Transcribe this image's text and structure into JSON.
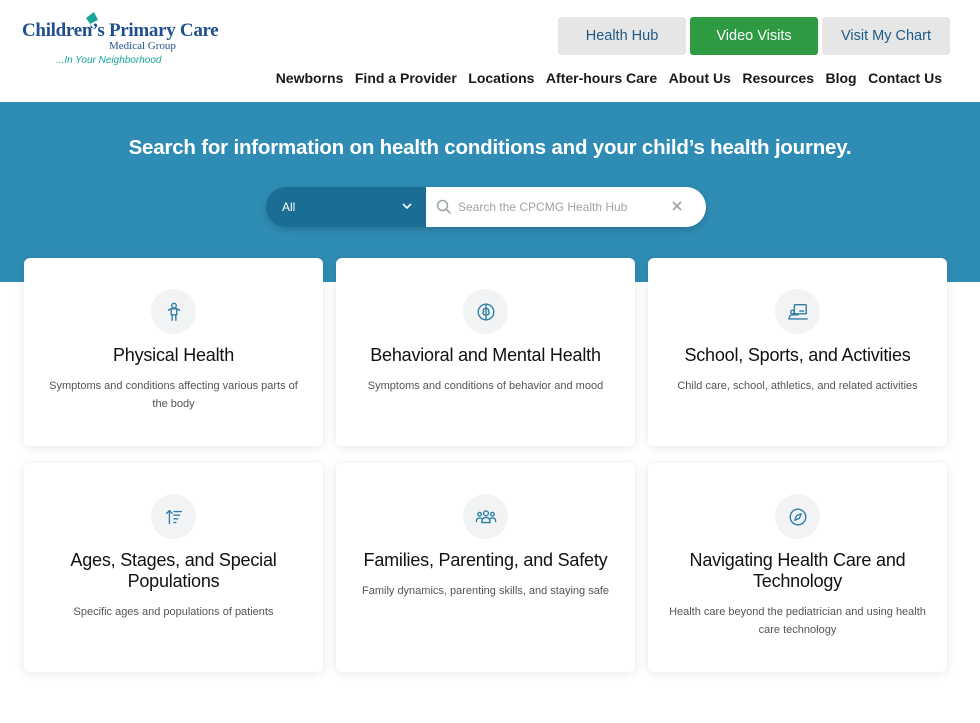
{
  "logo": {
    "main": "Children’s Primary Care",
    "sub": "Medical Group",
    "tagline": "...In Your Neighborhood"
  },
  "top_buttons": {
    "health_hub": "Health Hub",
    "video_visits": "Video Visits",
    "visit_my_chart": "Visit My Chart"
  },
  "nav": {
    "items": [
      "Newborns",
      "Find a Provider",
      "Locations",
      "After-hours Care",
      "About Us",
      "Resources",
      "Blog",
      "Contact Us"
    ]
  },
  "hero": {
    "title": "Search for information on health conditions and your child’s health journey."
  },
  "search": {
    "category": "All",
    "placeholder": "Search the CPCMG Health Hub",
    "value": ""
  },
  "cards": [
    {
      "title": "Physical Health",
      "description": "Symptoms and conditions affecting various parts of the body",
      "icon": "child-body-icon"
    },
    {
      "title": "Behavioral and Mental Health",
      "description": "Symptoms and conditions of behavior and mood",
      "icon": "brain-icon"
    },
    {
      "title": "School, Sports, and Activities",
      "description": "Child care, school, athletics, and related activities",
      "icon": "classroom-icon"
    },
    {
      "title": "Ages, Stages, and Special Populations",
      "description": "Specific ages and populations of patients",
      "icon": "sort-ascending-icon"
    },
    {
      "title": "Families, Parenting, and Safety",
      "description": "Family dynamics, parenting skills, and staying safe",
      "icon": "people-group-icon"
    },
    {
      "title": "Navigating Health Care and Technology",
      "description": "Health care beyond the pediatrician and using health care technology",
      "icon": "compass-icon"
    }
  ],
  "colors": {
    "hero_bg": "#2f8db5",
    "select_bg": "#1a6e96",
    "video_green": "#2e9b43",
    "button_grey": "#e6e6e6",
    "icon_blue": "#2f7ea6",
    "logo_blue": "#1f4f8f",
    "logo_teal": "#1aa59c"
  }
}
